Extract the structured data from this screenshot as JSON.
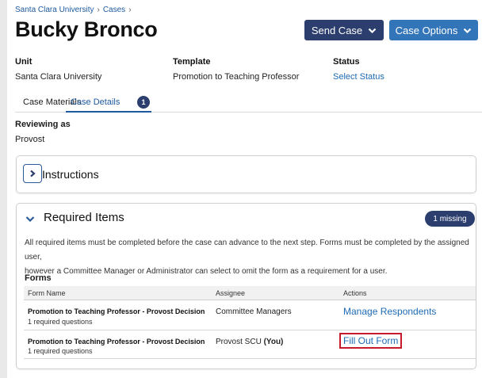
{
  "breadcrumb": {
    "items": [
      "Santa Clara University",
      "Cases"
    ]
  },
  "page_title": "Bucky Bronco",
  "header_buttons": {
    "send_case": "Send Case",
    "case_options": "Case Options"
  },
  "meta": {
    "unit_label": "Unit",
    "unit_value": "Santa Clara University",
    "template_label": "Template",
    "template_value": "Promotion to Teaching Professor",
    "status_label": "Status",
    "status_value": "Select Status"
  },
  "tabs": [
    {
      "label": "Case Materials"
    },
    {
      "label": "Case Details",
      "badge": "1",
      "active": true
    }
  ],
  "reviewing": {
    "label": "Reviewing as",
    "value": "Provost"
  },
  "instructions": {
    "label": "Instructions"
  },
  "required_items": {
    "title": "Required Items",
    "missing_badge": "1 missing",
    "description_line1": "All required items must be completed before the case can advance to the next step. Forms must be completed by the assigned user,",
    "description_line2": "however a Committee Manager or Administrator can select to omit the form as a requirement for a user."
  },
  "forms": {
    "heading": "Forms",
    "columns": [
      "Form Name",
      "Assignee",
      "Actions"
    ],
    "rows": [
      {
        "name": "Promotion to Teaching Professor - Provost Decision",
        "sub": "1 required questions",
        "assignee": "Committee Managers",
        "assignee_suffix": "",
        "action": "Manage Respondents"
      },
      {
        "name": "Promotion to Teaching Professor - Provost Decision",
        "sub": "1 required questions",
        "assignee": "Provost SCU",
        "assignee_suffix": "(You)",
        "action": "Fill Out Form"
      }
    ]
  },
  "colors": {
    "primary_dark": "#2c3e6d",
    "primary_blue": "#3375b9",
    "link": "#1e6ab4",
    "highlight_red": "#c8182b"
  },
  "icons": [
    "chevron-right-icon",
    "chevron-down-icon"
  ]
}
